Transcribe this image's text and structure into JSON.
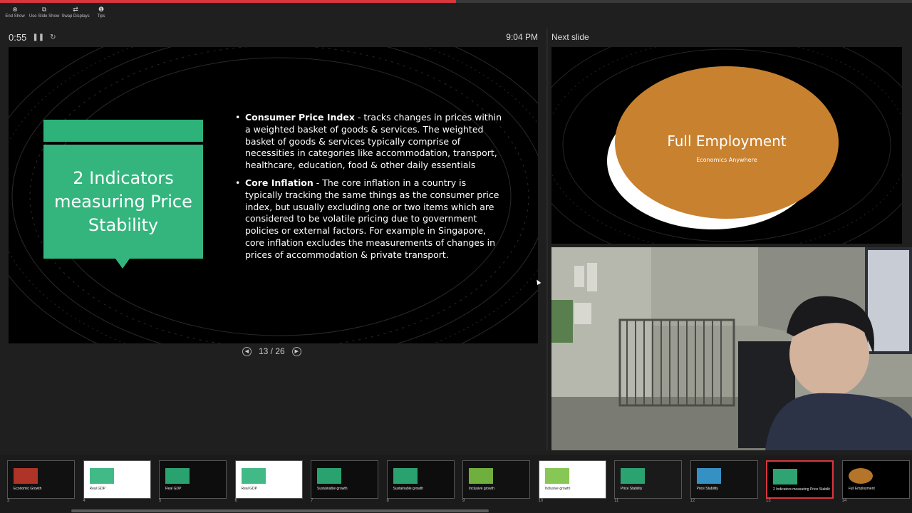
{
  "presenter": {
    "progress_percent": 50,
    "toolbar": [
      {
        "label": "End Show",
        "icon": "⊗",
        "name": "end-show-button"
      },
      {
        "label": "Use Slide Show",
        "icon": "⧉",
        "name": "use-slide-show-button"
      },
      {
        "label": "Swap Displays",
        "icon": "⇄",
        "name": "swap-displays-button"
      },
      {
        "label": "Tips",
        "icon": "❶",
        "name": "tips-button"
      }
    ],
    "elapsed": "0:55",
    "pause_icon": "❚❚",
    "reset_icon": "↻",
    "clock": "9:04 PM",
    "next_slide_label": "Next slide",
    "slide_counter": "13 / 26",
    "prev_icon": "◀",
    "next_icon": "▶"
  },
  "current_slide": {
    "title": "2 Indicators measuring Price Stability",
    "accent_color": "#34b57e",
    "bullets": [
      {
        "term": "Consumer Price Index",
        "text": " - tracks changes in prices within a weighted basket of goods & services. The weighted basket of goods & services typically comprise of necessities in categories like accommodation, transport, healthcare, education, food & other daily essentials"
      },
      {
        "term": "Core Inflation",
        "text": " - The core inflation in a country is typically tracking the same things as the consumer price index, but usually excluding one or two items which are considered to be volatile pricing due to government policies or external factors. For example in Singapore, core inflation excludes the measurements of changes in prices of accommodation & private transport."
      }
    ]
  },
  "next_slide": {
    "title": "Full Employment",
    "subtitle": "Economics Anywhere",
    "accent_color": "#c8812f"
  },
  "thumbnails": [
    {
      "number": "3",
      "text": "Economic Growth"
    },
    {
      "number": "4",
      "text": "Real GDP"
    },
    {
      "number": "5",
      "text": "Real GDP"
    },
    {
      "number": "6",
      "text": "Real GDP"
    },
    {
      "number": "7",
      "text": "Sustainable growth"
    },
    {
      "number": "8",
      "text": "Sustainable growth"
    },
    {
      "number": "9",
      "text": "Inclusive growth"
    },
    {
      "number": "10",
      "text": "Inclusive growth"
    },
    {
      "number": "11",
      "text": "Price Stability"
    },
    {
      "number": "12",
      "text": "Price Stability"
    },
    {
      "number": "13",
      "text": "2 Indicators measuring Price Stability"
    },
    {
      "number": "14",
      "text": "Full Employment"
    }
  ]
}
